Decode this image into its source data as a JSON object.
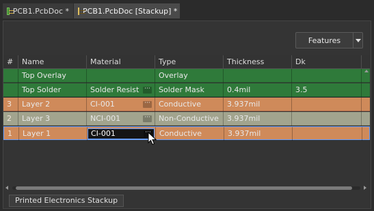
{
  "tabs": [
    {
      "label": "PCB1.PcbDoc *",
      "icon": "pcb-document-icon"
    },
    {
      "label": "PCB1.PcbDoc [Stackup] *",
      "icon": "stackup-document-icon"
    }
  ],
  "toolbar": {
    "features_label": "Features"
  },
  "columns": [
    "#",
    "Name",
    "Material",
    "Type",
    "Thickness",
    "Dk"
  ],
  "rows": [
    {
      "num": "",
      "name": "Top Overlay",
      "material": "",
      "type": "Overlay",
      "thickness": "",
      "dk": "",
      "color": "#2f7a3a"
    },
    {
      "num": "",
      "name": "Top Solder",
      "material": "Solder Resist",
      "type": "Solder Mask",
      "thickness": "0.4mil",
      "dk": "3.5",
      "color": "#2f7a3a"
    },
    {
      "num": "3",
      "name": "Layer 2",
      "material": "CI-001",
      "type": "Conductive",
      "thickness": "3.937mil",
      "dk": "",
      "color": "#cf8a5a"
    },
    {
      "num": "2",
      "name": "Layer 3",
      "material": "NCI-001",
      "type": "Non-Conductive",
      "thickness": "3.937mil",
      "dk": "",
      "color": "#a2a48e"
    },
    {
      "num": "1",
      "name": "Layer 1",
      "material": "CI-001",
      "type": "Conductive",
      "thickness": "3.937mil",
      "dk": "",
      "color": "#cf8a5a"
    }
  ],
  "ellipsis": "···",
  "bottom_tab": {
    "label": "Printed Electronics Stackup"
  }
}
